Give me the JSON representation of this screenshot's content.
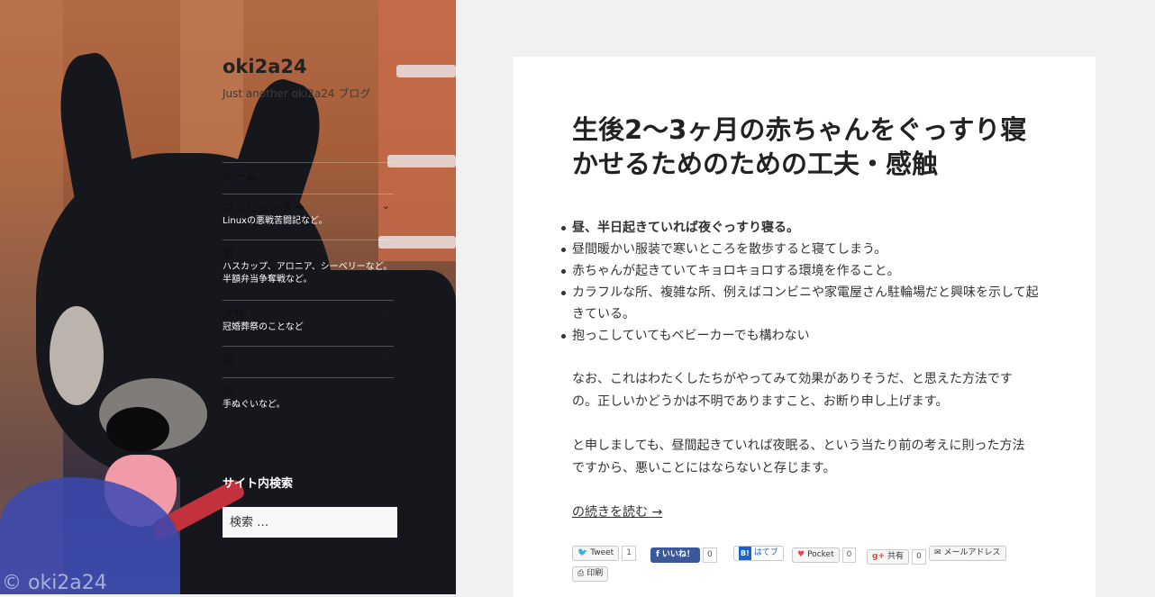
{
  "site": {
    "title": "oki2a24",
    "description": "Just another oki2a24 ブログ",
    "watermark": "© oki2a24"
  },
  "nav": {
    "items": [
      {
        "label": "ホーム",
        "desc": "",
        "has_submenu": false
      },
      {
        "label": "コンピューター",
        "desc": "Linuxの悪戦苦闘記など。",
        "has_submenu": true
      },
      {
        "label": "食",
        "desc": "ハスカップ、アロニア、シーベリーなど。半額弁当争奪戦など。",
        "has_submenu": false
      },
      {
        "label": "文化",
        "desc": "冠婚葬祭のことなど",
        "has_submenu": true
      },
      {
        "label": "住",
        "desc": "",
        "has_submenu": true
      },
      {
        "label": "衣",
        "desc": "手ぬぐいなど。",
        "has_submenu": false
      }
    ]
  },
  "search": {
    "title": "サイト内検索",
    "placeholder": "検索 …"
  },
  "post": {
    "title": "生後2〜3ヶ月の赤ちゃんをぐっすり寝かせるためのための工夫・感触",
    "bullets": [
      "昼、半日起きていれば夜ぐっすり寝る。",
      "昼間暖かい服装で寒いところを散歩すると寝てしまう。",
      "赤ちゃんが起きていてキョロキョロする環境を作ること。",
      "カラフルな所、複雑な所、例えばコンビニや家電屋さん駐輪場だと興味を示して起きている。",
      "抱っこしていてもベビーカーでも構わない"
    ],
    "paragraph1": "なお、これはわたくしたちがやってみて効果がありそうだ、と思えた方法ですの。正しいかどうかは不明でありますこと、お断り申し上げます。",
    "paragraph2": "と申しましても、昼間起きていれば夜眠る、という当たり前の考えに則った方法ですから、悪いことにはならないと存じます。",
    "more_link": "の続きを読む →"
  },
  "share": {
    "tweet": {
      "icon": "twitter-bird-icon",
      "label": "Tweet",
      "count": "1"
    },
    "facebook": {
      "icon": "facebook-f-icon",
      "label": "いいね！",
      "count": "0"
    },
    "hatena": {
      "icon": "hatena-b-icon",
      "icon_text": "B!",
      "label": "はてブ"
    },
    "pocket": {
      "icon": "pocket-icon",
      "label": "Pocket",
      "count": "0"
    },
    "gplus": {
      "icon": "google-plus-icon",
      "icon_text": "g+",
      "label": "共有",
      "count": "0"
    },
    "email": {
      "icon": "envelope-icon",
      "label": "メールアドレス"
    },
    "print": {
      "icon": "printer-icon",
      "label": "印刷"
    }
  }
}
